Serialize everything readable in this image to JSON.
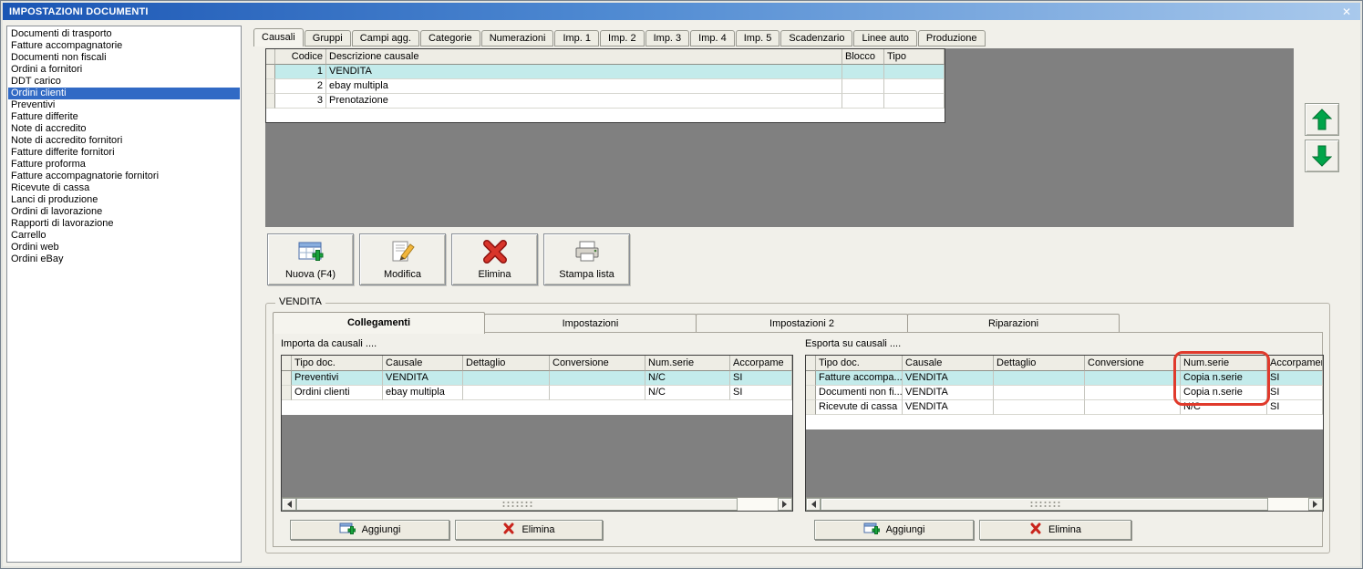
{
  "window": {
    "title": "IMPOSTAZIONI DOCUMENTI",
    "close_glyph": "✕"
  },
  "sidebar": {
    "items": [
      {
        "label": "Documenti di trasporto",
        "selected": false
      },
      {
        "label": "Fatture accompagnatorie",
        "selected": false
      },
      {
        "label": "Documenti non fiscali",
        "selected": false
      },
      {
        "label": "Ordini a fornitori",
        "selected": false
      },
      {
        "label": "DDT carico",
        "selected": false
      },
      {
        "label": "Ordini clienti",
        "selected": true
      },
      {
        "label": "Preventivi",
        "selected": false
      },
      {
        "label": "Fatture differite",
        "selected": false
      },
      {
        "label": "Note di accredito",
        "selected": false
      },
      {
        "label": "Note di accredito fornitori",
        "selected": false
      },
      {
        "label": "Fatture differite fornitori",
        "selected": false
      },
      {
        "label": "Fatture proforma",
        "selected": false
      },
      {
        "label": "Fatture accompagnatorie fornitori",
        "selected": false
      },
      {
        "label": "Ricevute di cassa",
        "selected": false
      },
      {
        "label": "Lanci di produzione",
        "selected": false
      },
      {
        "label": "Ordini di lavorazione",
        "selected": false
      },
      {
        "label": "Rapporti di lavorazione",
        "selected": false
      },
      {
        "label": "Carrello",
        "selected": false
      },
      {
        "label": "Ordini web",
        "selected": false
      },
      {
        "label": "Ordini eBay",
        "selected": false
      }
    ]
  },
  "main_tabs": [
    {
      "label": "Causali",
      "active": true
    },
    {
      "label": "Gruppi",
      "active": false
    },
    {
      "label": "Campi agg.",
      "active": false
    },
    {
      "label": "Categorie",
      "active": false
    },
    {
      "label": "Numerazioni",
      "active": false
    },
    {
      "label": "Imp. 1",
      "active": false
    },
    {
      "label": "Imp. 2",
      "active": false
    },
    {
      "label": "Imp. 3",
      "active": false
    },
    {
      "label": "Imp. 4",
      "active": false
    },
    {
      "label": "Imp. 5",
      "active": false
    },
    {
      "label": "Scadenzario",
      "active": false
    },
    {
      "label": "Linee auto",
      "active": false
    },
    {
      "label": "Produzione",
      "active": false
    }
  ],
  "causali_table": {
    "columns": {
      "codice": "Codice",
      "descrizione": "Descrizione causale",
      "blocco": "Blocco",
      "tipo": "Tipo"
    },
    "rows": [
      {
        "codice": "1",
        "descrizione": "VENDITA",
        "blocco": "",
        "tipo": "",
        "selected": true
      },
      {
        "codice": "2",
        "descrizione": "ebay multipla",
        "blocco": "",
        "tipo": "",
        "selected": false
      },
      {
        "codice": "3",
        "descrizione": "Prenotazione",
        "blocco": "",
        "tipo": "",
        "selected": false
      }
    ]
  },
  "toolbar": {
    "nuova": "Nuova (F4)",
    "modifica": "Modifica",
    "elimina": "Elimina",
    "stampa": "Stampa lista"
  },
  "detail": {
    "group_title": "VENDITA",
    "tabs": [
      {
        "label": "Collegamenti",
        "active": true
      },
      {
        "label": "Impostazioni",
        "active": false
      },
      {
        "label": "Impostazioni 2",
        "active": false
      },
      {
        "label": "Riparazioni",
        "active": false
      }
    ],
    "importa": {
      "title": "Importa da causali ....",
      "columns": [
        "",
        "Tipo doc.",
        "Causale",
        "Dettaglio",
        "Conversione",
        "Num.serie",
        "Accorpame"
      ],
      "rows": [
        [
          "Preventivi",
          "VENDITA",
          "",
          "",
          "N/C",
          "SI"
        ],
        [
          "Ordini clienti",
          "ebay multipla",
          "",
          "",
          "N/C",
          "SI"
        ]
      ],
      "selected_row": 0,
      "aggiungi": "Aggiungi",
      "elimina": "Elimina"
    },
    "esporta": {
      "title": "Esporta su causali ....",
      "columns": [
        "",
        "Tipo doc.",
        "Causale",
        "Dettaglio",
        "Conversione",
        "Num.serie",
        "Accorpamen"
      ],
      "rows": [
        [
          "Fatture accompa...",
          "VENDITA",
          "",
          "",
          "Copia n.serie",
          "SI"
        ],
        [
          "Documenti non fi...",
          "VENDITA",
          "",
          "",
          "Copia n.serie",
          "SI"
        ],
        [
          "Ricevute di cassa",
          "VENDITA",
          "",
          "",
          "N/C",
          "SI"
        ]
      ],
      "selected_row": 0,
      "aggiungi": "Aggiungi",
      "elimina": "Elimina"
    }
  },
  "colors": {
    "titlebar-start": "#1a55b4",
    "titlebar-end": "#a9c9ec",
    "selection-blue": "#316ac5",
    "row-highlight": "#c3ebeb",
    "annotation-red": "#e03a2c",
    "arrow-green": "#00a44a",
    "panel-gray": "#808080",
    "dialog-bg": "#f1f0ea"
  }
}
